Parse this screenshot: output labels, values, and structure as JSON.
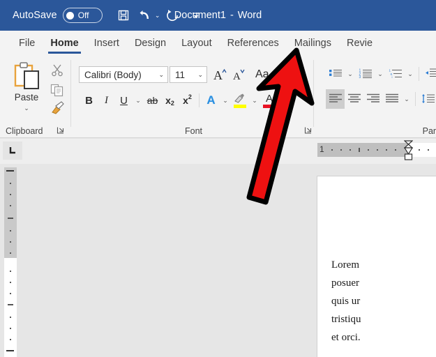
{
  "titlebar": {
    "autosave_label": "AutoSave",
    "autosave_state": "Off",
    "save_icon": "save-icon",
    "undo_icon": "undo-icon",
    "redo_icon": "redo-icon",
    "customize_icon": "customize-quick-access-toolbar-icon",
    "document_name": "Document1",
    "separator": "-",
    "app_name": "Word",
    "background_color": "#2b579a",
    "text_color": "#ffffff"
  },
  "tabs": [
    {
      "label": "File",
      "active": false
    },
    {
      "label": "Home",
      "active": true
    },
    {
      "label": "Insert",
      "active": false
    },
    {
      "label": "Design",
      "active": false
    },
    {
      "label": "Layout",
      "active": false
    },
    {
      "label": "References",
      "active": false
    },
    {
      "label": "Mailings",
      "active": false
    },
    {
      "label": "Revie",
      "active": false
    }
  ],
  "ribbon": {
    "accent_color": "#2b579a",
    "background_color": "#f3f3f3",
    "clipboard": {
      "label": "Clipboard",
      "paste_label": "Paste",
      "paste_caret": "⌄",
      "cut_icon": "scissors-icon",
      "copy_icon": "copy-icon",
      "format_painter_icon": "format-painter-icon",
      "dialog_launcher_icon": "dialog-box-launcher-icon"
    },
    "font": {
      "label": "Font",
      "font_name_value": "Calibri (Body)",
      "font_size_value": "11",
      "caret": "⌄",
      "grow_font": "A",
      "shrink_font": "A",
      "change_case": "Aa",
      "clear_formatting_icon": "clear-formatting-eraser-icon",
      "bold": "B",
      "italic": "I",
      "underline": "U",
      "strikethrough": "ab",
      "subscript": "x",
      "subscript_sub": "2",
      "superscript": "x",
      "superscript_sup": "2",
      "text_effects": "A",
      "highlight_icon": "text-highlight-color-icon",
      "highlight_color": "#ffff00",
      "font_color_letter": "A",
      "font_color": "#e81123",
      "dialog_launcher_icon": "dialog-box-launcher-icon"
    },
    "paragraph": {
      "label": "Parag",
      "bullets_icon": "bullet-list-icon",
      "numbering_icon": "numbered-list-icon",
      "multilevel_icon": "multilevel-list-icon",
      "decrease_indent_icon": "decrease-indent-icon",
      "align_left_icon": "align-left-icon",
      "align_center_icon": "align-center-icon",
      "align_right_icon": "align-right-icon",
      "justify_icon": "justify-icon",
      "line_spacing_icon": "line-spacing-icon",
      "caret": "⌄",
      "active_alignment": "align-left-icon"
    }
  },
  "ruler": {
    "tab_selector_icon": "left-tab-stop-icon",
    "horizontal_mark": "1",
    "indent_marker_icon": "indent-marker-icon"
  },
  "document": {
    "page_background": "#ffffff",
    "workspace_background": "#e6e6e6",
    "body_lines": [
      "Lorem",
      "posuer",
      "quis ur",
      "tristiqu",
      "et orci."
    ]
  },
  "annotation": {
    "arrow_icon": "red-arrow-pointer",
    "arrow_color": "#ee1111",
    "arrow_outline_color": "#000000",
    "points_to": "References"
  }
}
